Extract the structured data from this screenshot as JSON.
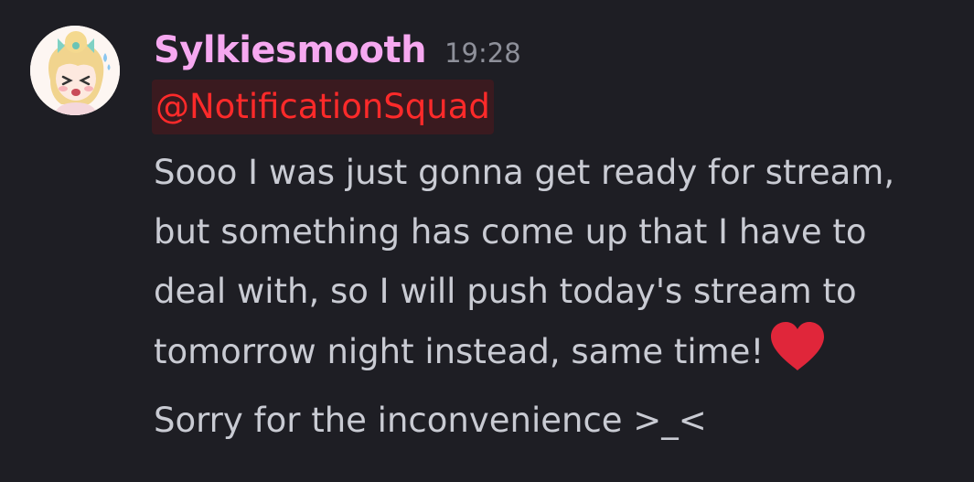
{
  "message": {
    "username": "Sylkiesmooth",
    "timestamp": "19:28",
    "mention": "@NotificationSquad",
    "lines": [
      "Sooo I was just gonna get ready for stream,",
      "but something has come up that I have to",
      "deal with, so I will push today's stream to",
      "tomorrow night instead, same time!",
      "Sorry for the inconvenience >_<"
    ],
    "emoji": "red-heart-icon"
  },
  "colors": {
    "background": "#1e1e24",
    "username": "#f6a8f0",
    "mention_text": "#ff2a2a",
    "mention_bg": "#3a1a1f",
    "text": "#c9cbd3",
    "timestamp": "#8e909a",
    "heart": "#e0263a"
  }
}
